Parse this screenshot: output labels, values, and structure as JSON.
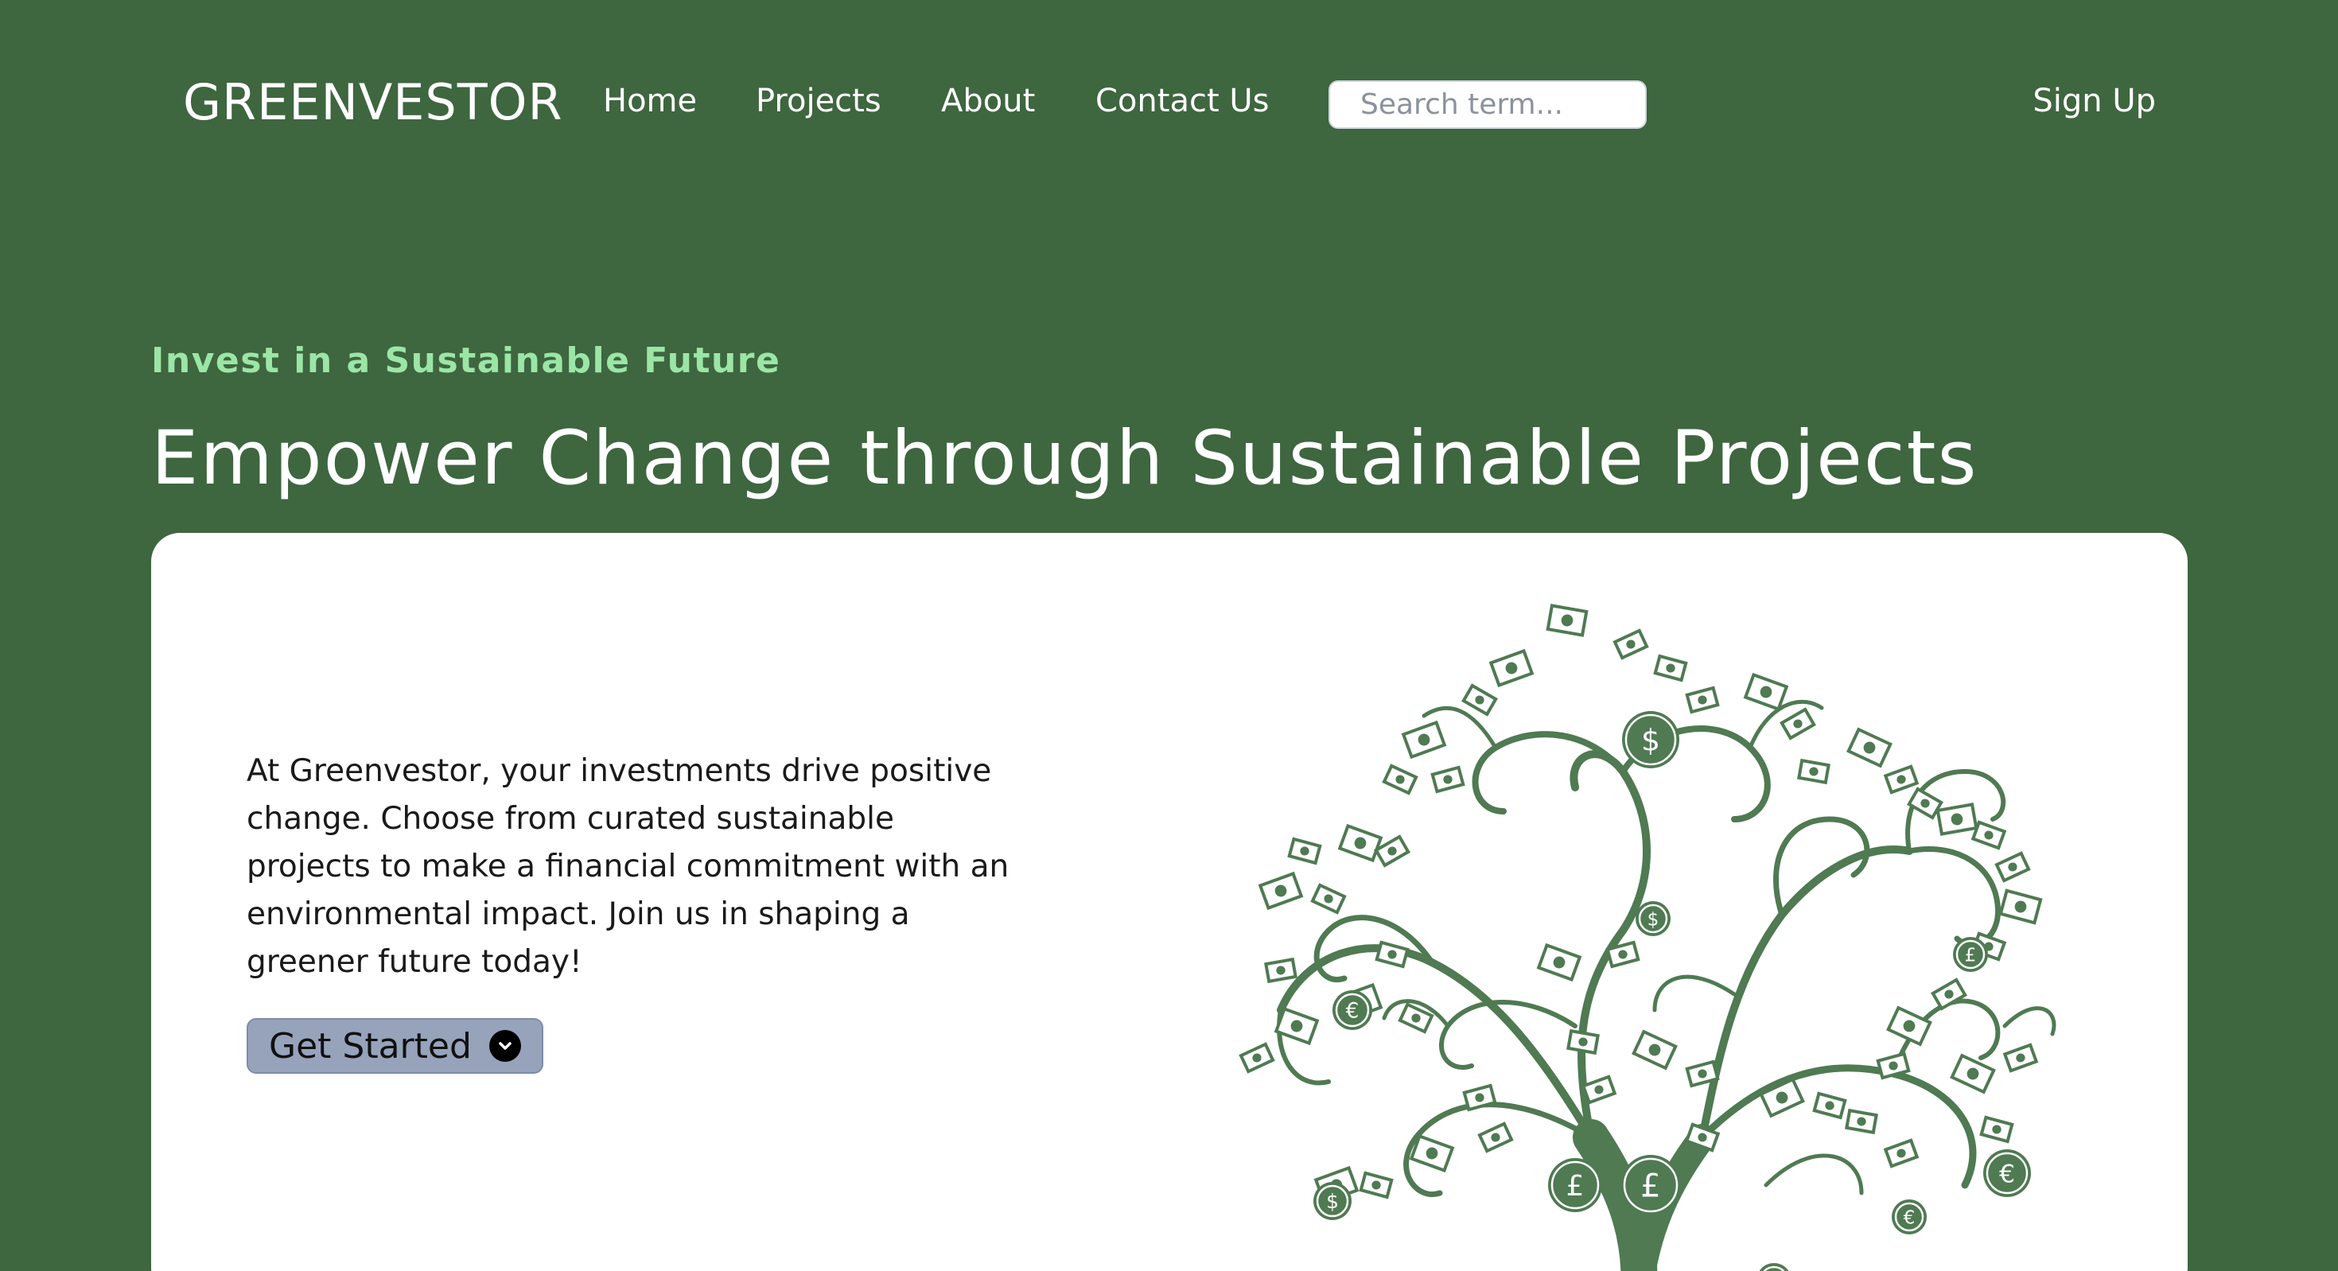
{
  "nav": {
    "logo": "GREENVESTOR",
    "links": [
      "Home",
      "Projects",
      "About",
      "Contact Us"
    ],
    "search_placeholder": "Search term...",
    "signup": "Sign Up"
  },
  "hero": {
    "eyebrow": "Invest in a Sustainable Future",
    "headline": "Empower Change through Sustainable Projects",
    "description": "At Greenvestor, your investments drive positive change. Choose from curated sustainable projects to make a financial commitment with an environmental impact. Join us in shaping a greener future today!",
    "cta_label": "Get Started",
    "cta_icon": "chevron-down-icon"
  },
  "illustration": {
    "name": "money-tree",
    "currency_symbols": [
      "$",
      "£",
      "€",
      "$",
      "£",
      "€",
      "£",
      "$",
      "€",
      "$"
    ],
    "color": "#4f7a52"
  },
  "colors": {
    "background": "#3e663f",
    "accent": "#9be6a7",
    "button": "#96a3bb"
  }
}
